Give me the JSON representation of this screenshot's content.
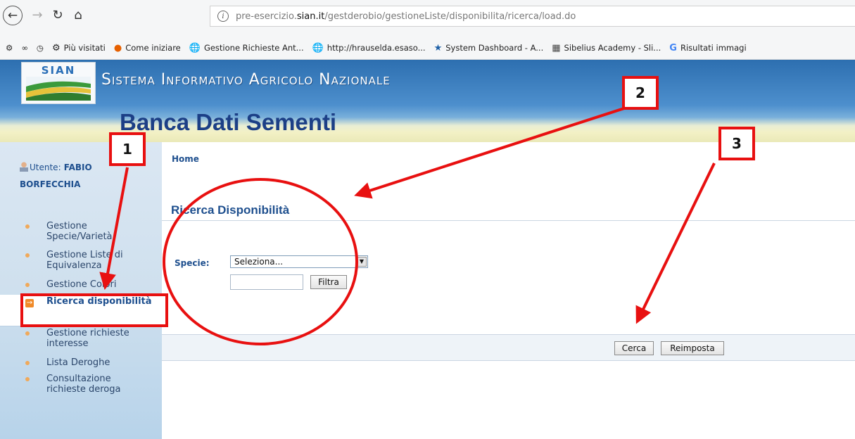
{
  "browser": {
    "url_prefix": "pre-esercizio.",
    "url_domain": "sian.it",
    "url_path": "/gestderobio/gestioneListe/disponibilita/ricerca/load.do",
    "bookmarks": [
      "Più visitati",
      "Come iniziare",
      "Gestione Richieste Ant...",
      "http://hrauselda.esaso...",
      "System Dashboard - A...",
      "Sibelius Academy - Sli...",
      "Risultati immagi"
    ]
  },
  "header": {
    "logo_text": "SIAN",
    "title": "Sistema Informativo Agricolo Nazionale",
    "subtitle": "Banca Dati Sementi"
  },
  "user": {
    "label": "Utente:",
    "first_name": "FABIO",
    "last_name": "BORFECCHIA"
  },
  "menu": [
    "Gestione Specie/Varietà",
    "Gestione Liste di Equivalenza",
    "Gestione Colori",
    "Ricerca disponibilità",
    "Gestione richieste interesse",
    "Lista Deroghe",
    "Consultazione richieste deroga"
  ],
  "content": {
    "breadcrumb": "Home",
    "title": "Ricerca Disponibilità",
    "specie_label": "Specie:",
    "specie_value": "Seleziona...",
    "filter_button": "Filtra",
    "search_button": "Cerca",
    "reset_button": "Reimposta"
  },
  "annotations": {
    "callouts": [
      "1",
      "2",
      "3"
    ],
    "color": "#e81010"
  }
}
